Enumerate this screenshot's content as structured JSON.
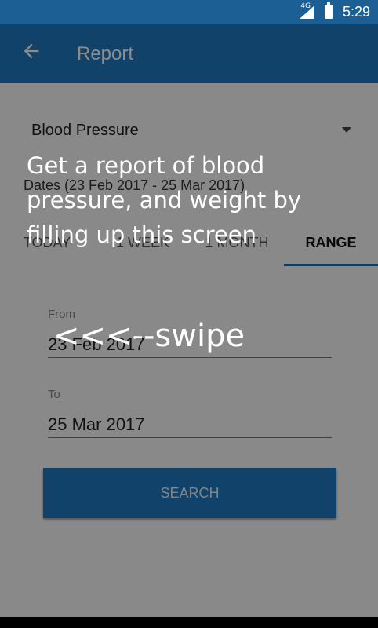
{
  "status_bar": {
    "network": "4G",
    "time": "5:29"
  },
  "app_bar": {
    "title": "Report",
    "back_icon": "arrow-left-icon"
  },
  "form": {
    "measurement": "Blood Pressure",
    "dates_label": "Dates (23 Feb 2017 - 25 Mar 2017)",
    "tabs": [
      {
        "label": "TODAY",
        "active": false
      },
      {
        "label": "1 WEEK",
        "active": false
      },
      {
        "label": "1 MONTH",
        "active": false
      },
      {
        "label": "RANGE",
        "active": true
      }
    ],
    "from": {
      "label": "From",
      "value": "23 Feb 2017"
    },
    "to": {
      "label": "To",
      "value": "25 Mar 2017"
    },
    "search_label": "SEARCH"
  },
  "overlay": {
    "hint": "Get a report of blood pressure, and weight by filling up this screen",
    "swipe": "<<<--swipe"
  },
  "colors": {
    "app_bar": "#2079c2",
    "status_bar": "#1c5f94",
    "accent": "#1f6bb0"
  }
}
